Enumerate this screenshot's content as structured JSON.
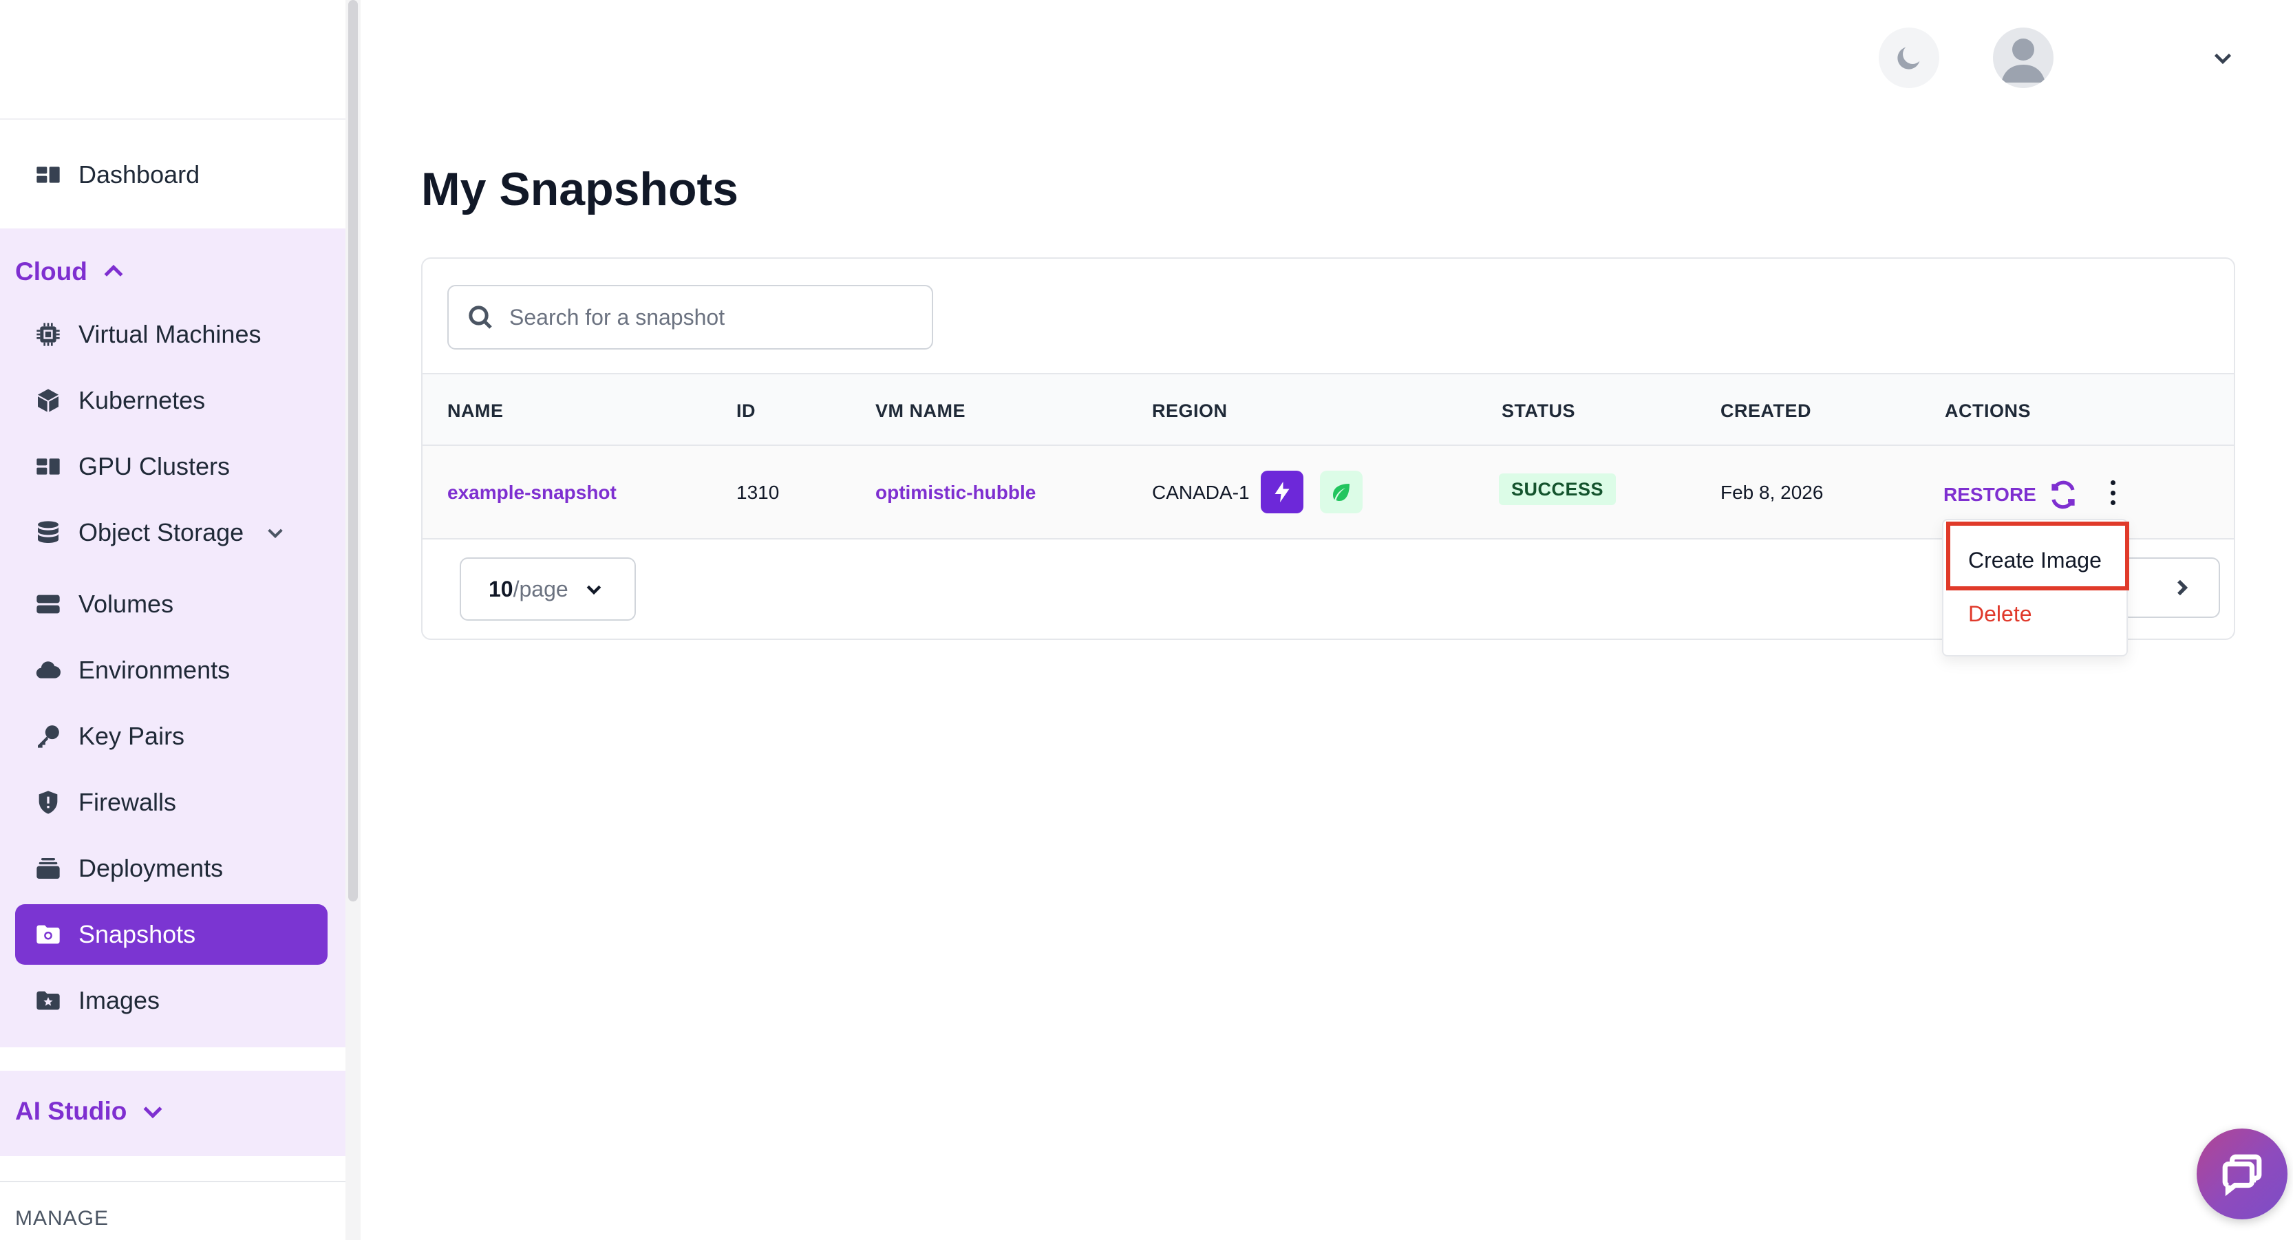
{
  "sidebar": {
    "dashboard_label": "Dashboard",
    "cloud_section_label": "Cloud",
    "items": [
      {
        "label": "Virtual Machines",
        "icon": "chip-icon"
      },
      {
        "label": "Kubernetes",
        "icon": "cube-icon"
      },
      {
        "label": "GPU Clusters",
        "icon": "grid-icon"
      },
      {
        "label": "Object Storage",
        "icon": "database-icon"
      },
      {
        "label": "Volumes",
        "icon": "server-icon"
      },
      {
        "label": "Environments",
        "icon": "cloud-icon"
      },
      {
        "label": "Key Pairs",
        "icon": "key-icon"
      },
      {
        "label": "Firewalls",
        "icon": "shield-icon"
      },
      {
        "label": "Deployments",
        "icon": "stack-icon"
      },
      {
        "label": "Snapshots",
        "icon": "snapshot-folder-icon"
      },
      {
        "label": "Images",
        "icon": "image-folder-icon"
      }
    ],
    "ai_section_label": "AI Studio",
    "manage_label": "MANAGE"
  },
  "header": {
    "theme_toggle_icon": "moon-icon",
    "avatar_icon": "user-icon"
  },
  "main": {
    "title": "My Snapshots",
    "search": {
      "placeholder": "Search for a snapshot",
      "value": ""
    },
    "columns": [
      "NAME",
      "ID",
      "VM NAME",
      "REGION",
      "STATUS",
      "CREATED",
      "ACTIONS"
    ],
    "rows": [
      {
        "name": "example-snapshot",
        "id": "1310",
        "vm_name": "optimistic-hubble",
        "region": "CANADA-1",
        "status": "SUCCESS",
        "created": "Feb 8, 2026",
        "restore_label": "RESTORE"
      }
    ],
    "pagination": {
      "per_page_value": "10",
      "per_page_unit": "/page"
    }
  },
  "action_menu": {
    "create_image_label": "Create Image",
    "delete_label": "Delete"
  },
  "colors": {
    "accent": "#7b35d2",
    "accent_text": "#7e2fd0",
    "section_bg": "#f3eafc",
    "success_bg": "#dcfce7",
    "danger": "#e0392b",
    "highlight": "#e03a2a"
  }
}
